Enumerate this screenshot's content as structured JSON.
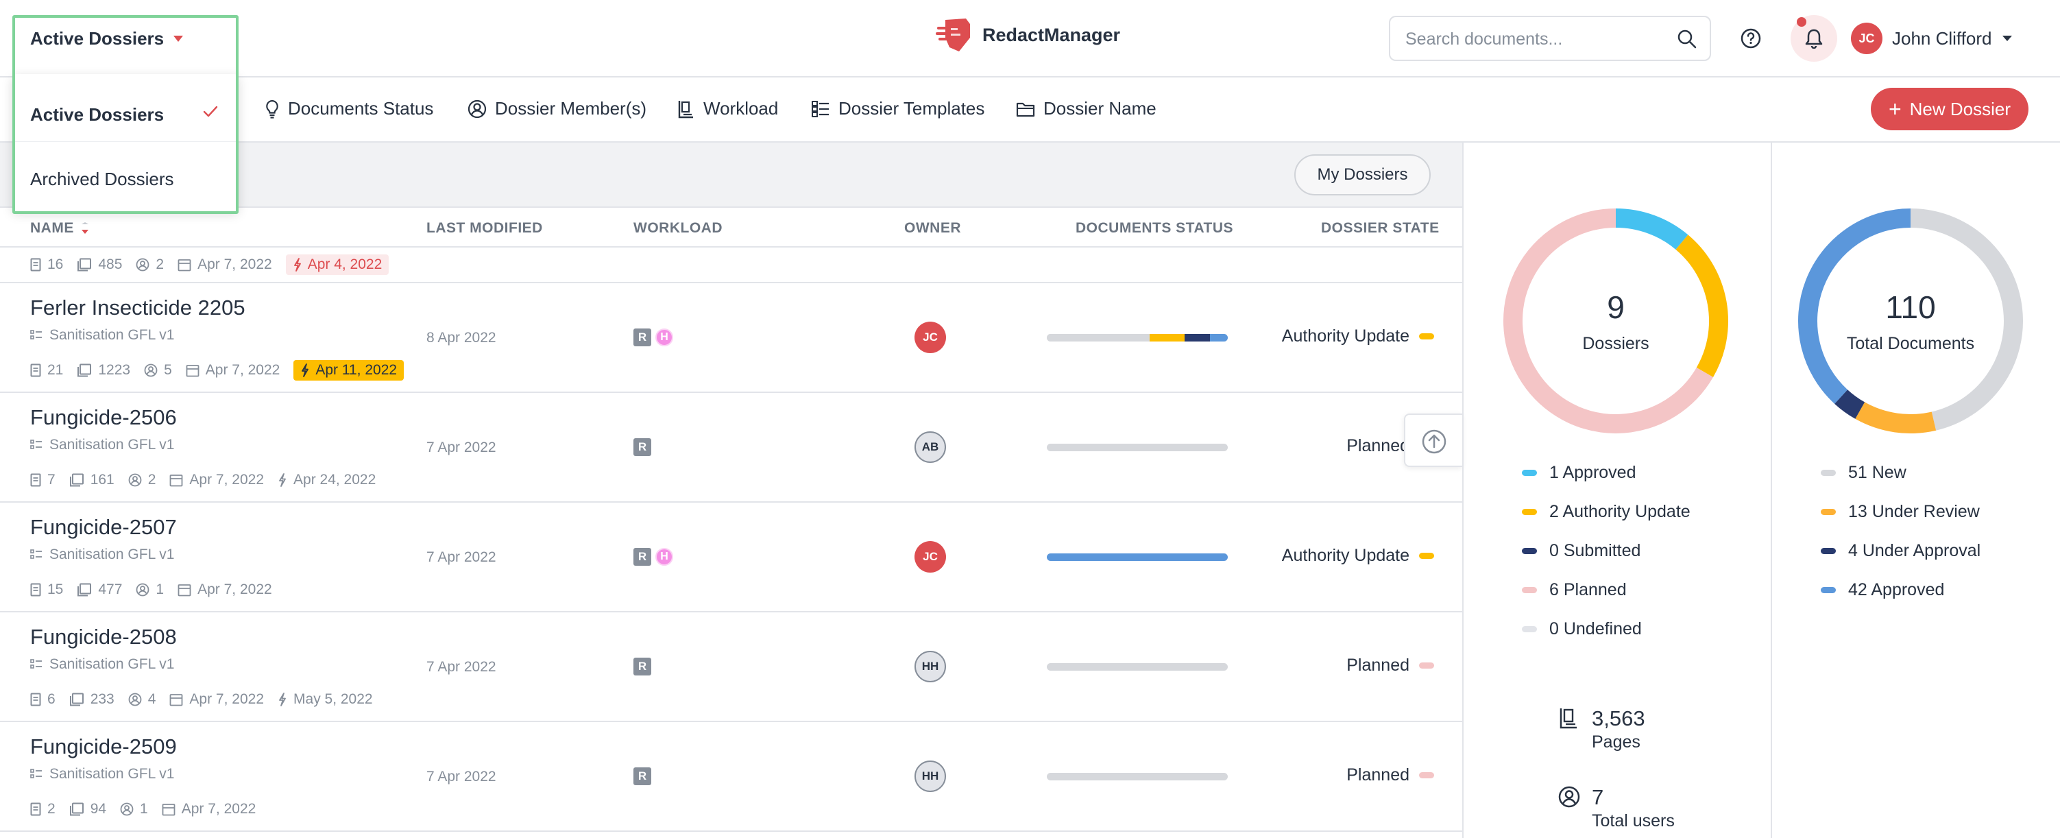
{
  "header": {
    "brand": "RedactManager",
    "search_placeholder": "Search documents...",
    "user": {
      "initials": "JC",
      "name": "John Clifford"
    }
  },
  "dossier_filter": {
    "selected": "Active Dossiers",
    "options": [
      {
        "label": "Active Dossiers",
        "selected": true
      },
      {
        "label": "Archived Dossiers",
        "selected": false
      }
    ]
  },
  "filters": {
    "items": [
      {
        "label": "Documents Status",
        "icon": "lightbulb-icon"
      },
      {
        "label": "Dossier Member(s)",
        "icon": "user-circle-icon"
      },
      {
        "label": "Workload",
        "icon": "workload-icon"
      },
      {
        "label": "Dossier Templates",
        "icon": "templates-icon"
      },
      {
        "label": "Dossier Name",
        "icon": "folder-icon"
      }
    ],
    "new_dossier": "New Dossier"
  },
  "toolbar": {
    "my_dossiers": "My Dossiers"
  },
  "table": {
    "headers": {
      "name": "NAME",
      "last_modified": "LAST MODIFIED",
      "workload": "WORKLOAD",
      "owner": "OWNER",
      "documents_status": "DOCUMENTS STATUS",
      "dossier_state": "DOSSIER STATE"
    },
    "partial_row": {
      "docs": "16",
      "pages": "485",
      "members": "2",
      "created": "Apr 7, 2022",
      "due": "Apr 4, 2022"
    },
    "rows": [
      {
        "name": "Ferler Insecticide 2205",
        "template": "Sanitisation GFL v1",
        "docs": "21",
        "pages": "1223",
        "members": "5",
        "created": "Apr 7, 2022",
        "due": "Apr 11, 2022",
        "due_style": "yellow",
        "modified": "8 Apr 2022",
        "workload": [
          "R",
          "H"
        ],
        "owner": "JC",
        "state": "Authority Update",
        "state_color": "#fdbd00",
        "doc_status": [
          {
            "status": "New",
            "fraction": 0.57,
            "color": "#d6d8dc"
          },
          {
            "status": "Under Review",
            "fraction": 0.19,
            "color": "#fdbd00"
          },
          {
            "status": "Under Approval",
            "fraction": 0.14,
            "color": "#283a6e"
          },
          {
            "status": "Approved",
            "fraction": 0.1,
            "color": "#5b97db"
          }
        ]
      },
      {
        "name": "Fungicide-2506",
        "template": "Sanitisation GFL v1",
        "docs": "7",
        "pages": "161",
        "members": "2",
        "created": "Apr 7, 2022",
        "due": "Apr 24, 2022",
        "due_style": "plain",
        "modified": "7 Apr 2022",
        "workload": [
          "R"
        ],
        "owner": "AB",
        "state": "Planned",
        "state_color": "#f4c5c6",
        "doc_status": [
          {
            "status": "New",
            "fraction": 1.0,
            "color": "#d6d8dc"
          }
        ]
      },
      {
        "name": "Fungicide-2507",
        "template": "Sanitisation GFL v1",
        "docs": "15",
        "pages": "477",
        "members": "1",
        "created": "Apr 7, 2022",
        "due": "",
        "due_style": "none",
        "modified": "7 Apr 2022",
        "workload": [
          "R",
          "H"
        ],
        "owner": "JC",
        "state": "Authority Update",
        "state_color": "#fdbd00",
        "doc_status": [
          {
            "status": "Approved",
            "fraction": 1.0,
            "color": "#5b97db"
          }
        ]
      },
      {
        "name": "Fungicide-2508",
        "template": "Sanitisation GFL v1",
        "docs": "6",
        "pages": "233",
        "members": "4",
        "created": "Apr 7, 2022",
        "due": "May 5, 2022",
        "due_style": "plain",
        "modified": "7 Apr 2022",
        "workload": [
          "R"
        ],
        "owner": "HH",
        "state": "Planned",
        "state_color": "#f4c5c6",
        "doc_status": [
          {
            "status": "New",
            "fraction": 1.0,
            "color": "#d6d8dc"
          }
        ]
      },
      {
        "name": "Fungicide-2509",
        "template": "Sanitisation GFL v1",
        "docs": "2",
        "pages": "94",
        "members": "1",
        "created": "Apr 7, 2022",
        "due": "",
        "due_style": "none",
        "modified": "7 Apr 2022",
        "workload": [
          "R"
        ],
        "owner": "HH",
        "state": "Planned",
        "state_color": "#f4c5c6",
        "doc_status": [
          {
            "status": "New",
            "fraction": 1.0,
            "color": "#d6d8dc"
          }
        ]
      }
    ]
  },
  "stats": {
    "dossiers": {
      "total": "9",
      "label": "Dossiers",
      "legend": [
        {
          "label": "1 Approved",
          "count": 1,
          "color": "#45c1f0"
        },
        {
          "label": "2 Authority Update",
          "count": 2,
          "color": "#fdbd00"
        },
        {
          "label": "0 Submitted",
          "count": 0,
          "color": "#283a6e"
        },
        {
          "label": "6 Planned",
          "count": 6,
          "color": "#f4c5c6"
        },
        {
          "label": "0 Undefined",
          "count": 0,
          "color": "#e2e4e9"
        }
      ]
    },
    "documents": {
      "total": "110",
      "label": "Total Documents",
      "legend": [
        {
          "label": "51 New",
          "count": 51,
          "color": "#d6d8dc"
        },
        {
          "label": "13 Under Review",
          "count": 13,
          "color": "#fdb135"
        },
        {
          "label": "4 Under Approval",
          "count": 4,
          "color": "#283a6e"
        },
        {
          "label": "42 Approved",
          "count": 42,
          "color": "#5b97db"
        }
      ]
    },
    "pages": {
      "value": "3,563",
      "label": "Pages"
    },
    "users": {
      "value": "7",
      "label": "Total users"
    }
  }
}
